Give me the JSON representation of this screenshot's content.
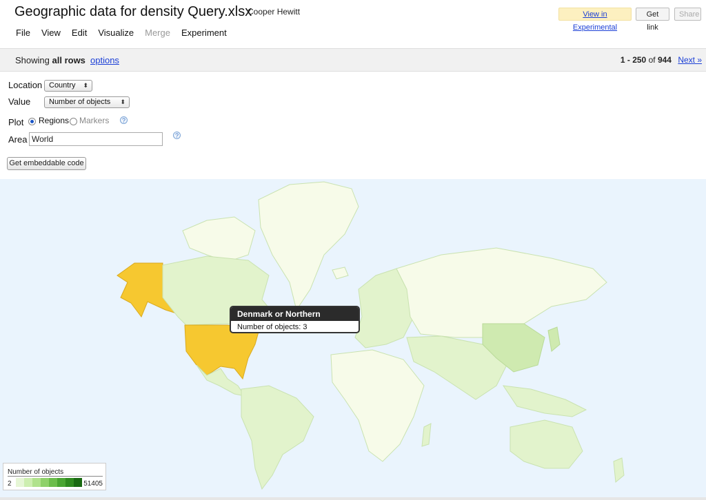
{
  "header": {
    "doc_title": "Geographic data for density Query.xlsx",
    "owner": "Cooper Hewitt",
    "view_experimental": "View in Experimental",
    "get_link": "Get link",
    "share": "Share"
  },
  "menu": [
    "File",
    "View",
    "Edit",
    "Visualize",
    "Merge",
    "Experiment"
  ],
  "rows_bar": {
    "showing_prefix": "Showing",
    "showing_bold": "all rows",
    "options": "options",
    "range": "1 - 250",
    "of": "of",
    "total": "944",
    "next": "Next »"
  },
  "controls": {
    "location_label": "Location",
    "location_value": "Country",
    "value_label": "Value",
    "value_value": "Number of objects",
    "plot_label": "Plot",
    "plot_regions": "Regions",
    "plot_markers": "Markers",
    "plot_selected": "Regions",
    "area_label": "Area",
    "area_value": "World",
    "help_glyph": "?",
    "embed_button": "Get embeddable code"
  },
  "tooltip": {
    "title": "Denmark or Northern Germany",
    "body": "Number of objects: 3"
  },
  "legend": {
    "title": "Number of objects",
    "min": "2",
    "max": "51405",
    "colors": [
      "#e6f6d6",
      "#cdeeb0",
      "#b0e28c",
      "#8fd16a",
      "#6cbd4b",
      "#4aa532",
      "#2f8a1f",
      "#1a6a12"
    ]
  },
  "colors": {
    "ocean": "#eaf4fd",
    "land_low": "#f7fbe9",
    "land_mid": "#e2f3cc",
    "land_green": "#cfeab0",
    "highlight": "#f6c830",
    "link": "#1a3ed6"
  }
}
